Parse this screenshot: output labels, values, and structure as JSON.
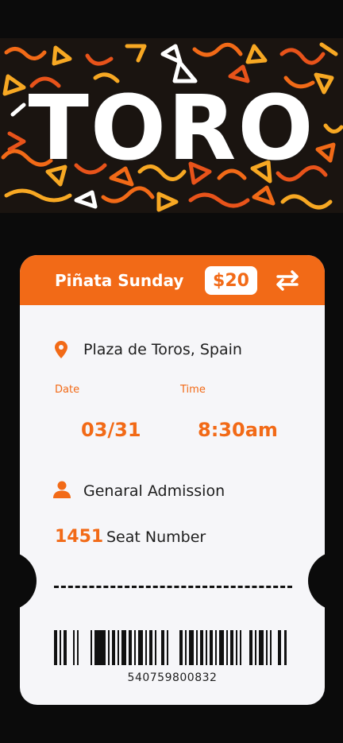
{
  "hero": {
    "title": "TORO"
  },
  "ticket": {
    "event_name": "Piñata Sunday",
    "price": "$20",
    "location": "Plaza de Toros, Spain",
    "date_label": "Date",
    "date_value": "03/31",
    "time_label": "Time",
    "time_value": "8:30am",
    "admission": "Genaral Admission",
    "seat_number": "1451",
    "seat_label": "Seat Number",
    "barcode_number": "540759800832"
  },
  "icons": {
    "location": "map-pin-icon",
    "person": "person-icon",
    "swap": "swap-arrows-icon"
  },
  "colors": {
    "accent": "#f26a17",
    "ticket_bg": "#f6f6f9",
    "page_bg": "#0b0b0b"
  }
}
